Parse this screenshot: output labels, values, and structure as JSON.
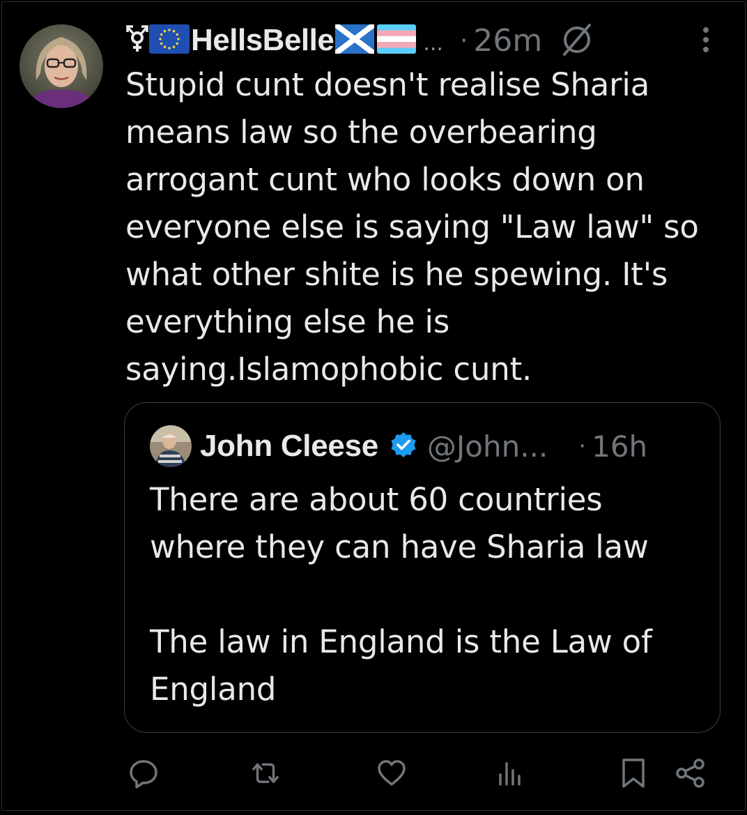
{
  "tweet": {
    "author_name": "HellsBelle",
    "truncation": "...",
    "separator": "·",
    "timestamp": "26m",
    "text": "Stupid cunt doesn't realise Sharia\nmeans law so the overbearing\narrogant cunt who looks down on\neveryone else is saying \"Law law\" so\nwhat other shite is he spewing. It's\neverything else he is\nsaying.Islamophobic cunt."
  },
  "quote": {
    "author_name": "John Cleese",
    "handle": "@John...",
    "separator": "·",
    "timestamp": "16h",
    "text": "There are about 60 countries\nwhere they can have Sharia law\n\nThe law in England is the Law of\nEngland"
  },
  "icons": {
    "gender": "transgender-symbol-icon",
    "eu_flag": "eu-flag-icon",
    "scotland_flag": "scotland-flag-icon",
    "trans_flag": "trans-pride-flag-icon",
    "no_access": "no-symbol-icon",
    "more": "more-vertical-icon",
    "verified": "verified-badge-icon",
    "reply": "reply-icon",
    "retweet": "retweet-icon",
    "like": "heart-icon",
    "views": "views-icon",
    "bookmark": "bookmark-icon",
    "share": "share-icon"
  },
  "colors": {
    "background": "#000000",
    "text": "#e7e9ea",
    "secondary": "#71767b",
    "verified_blue": "#1d9bf0",
    "border": "#2f3336"
  }
}
